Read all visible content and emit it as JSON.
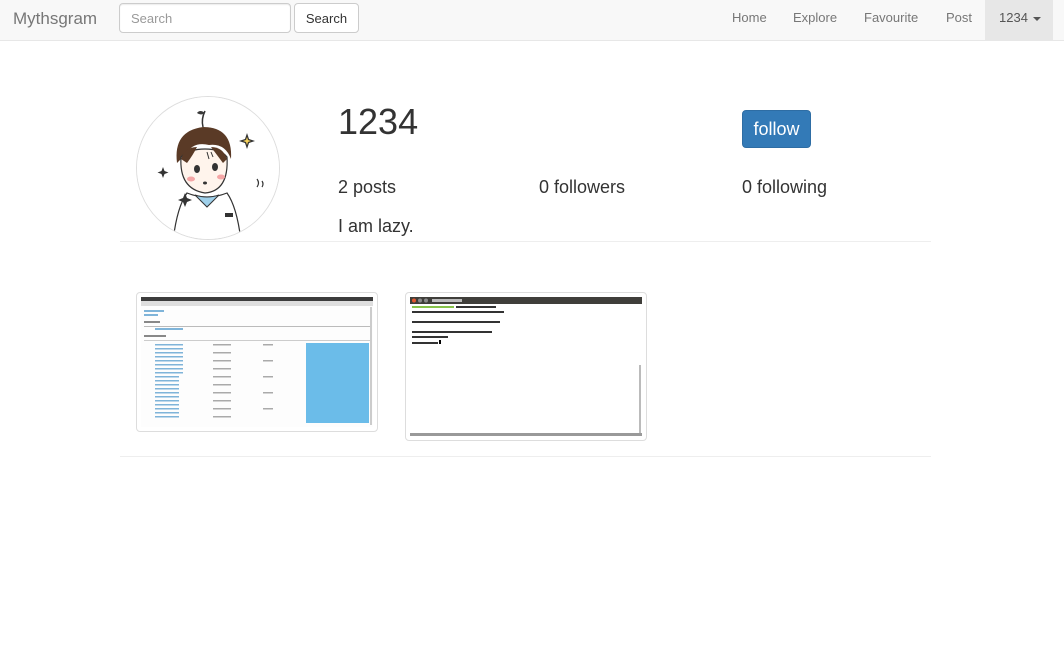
{
  "navbar": {
    "brand": "Mythsgram",
    "search_placeholder": "Search",
    "search_button": "Search",
    "links": {
      "home": "Home",
      "explore": "Explore",
      "favourite": "Favourite",
      "post": "Post"
    },
    "user_menu": "1234"
  },
  "profile": {
    "username": "1234",
    "follow_button": "follow",
    "posts": "2 posts",
    "followers": "0 followers",
    "following": "0 following",
    "bio": "I am lazy."
  },
  "colors": {
    "primary": "#337ab7",
    "navbar_bg": "#f8f8f8",
    "user_menu_bg": "#e7e7e7"
  },
  "posts": [
    {
      "icon": "spreadsheet-screenshot-thumbnail"
    },
    {
      "icon": "terminal-screenshot-thumbnail"
    }
  ]
}
